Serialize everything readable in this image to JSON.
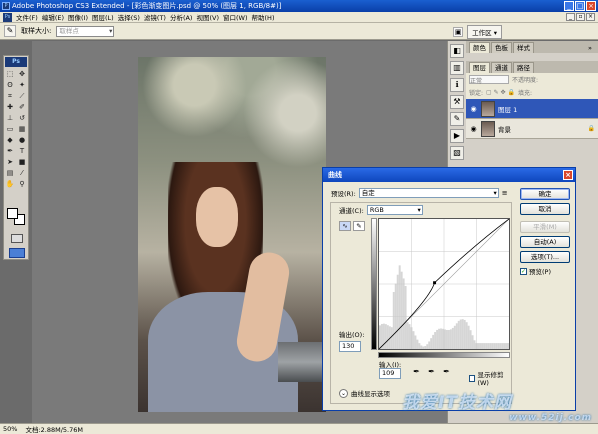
{
  "app": {
    "title": "Adobe Photoshop CS3 Extended - [彩色渐变图片.psd @ 50% (图层 1, RGB/8#)]",
    "ps_badge": "Ps"
  },
  "menubar": {
    "items": [
      "文件(F)",
      "编辑(E)",
      "图像(I)",
      "图层(L)",
      "选择(S)",
      "滤镜(T)",
      "分析(A)",
      "视图(V)",
      "窗口(W)",
      "帮助(H)"
    ]
  },
  "optionsbar": {
    "sample_size_label": "取样大小:",
    "sample_size_value": "取样点",
    "workspace_label": "工作区 ▾"
  },
  "panels": {
    "top_tabs": [
      "颜色",
      "色板",
      "样式"
    ],
    "layer_tabs": [
      "图层",
      "通道",
      "路径"
    ],
    "blend_mode": "正常",
    "opacity_label": "不透明度:",
    "lock_label": "锁定:",
    "fill_label": "填充:",
    "layers": [
      {
        "name": "图层 1",
        "selected": true
      },
      {
        "name": "背景",
        "selected": false
      }
    ]
  },
  "status": {
    "zoom": "50%",
    "doc_info": "文档:2.88M/5.76M"
  },
  "curves_dialog": {
    "title": "曲线",
    "preset_label": "预设(R):",
    "preset_value": "自定",
    "channel_label": "通道(C):",
    "channel_value": "RGB",
    "output_label": "输出(O):",
    "output_value": "130",
    "input_label": "输入(I):",
    "input_value": "109",
    "clipping_label": "显示修剪(W)",
    "display_options_label": "曲线显示选项",
    "buttons": {
      "ok": "确定",
      "cancel": "取消",
      "smooth": "平滑(M)",
      "auto": "自动(A)",
      "options": "选项(T)...",
      "preview": "预览(P)"
    },
    "preview_checked": true,
    "curve_point": {
      "input": 109,
      "output": 130
    }
  },
  "watermark": {
    "text": "我爱IT技术网",
    "sub": "www.52ij.com"
  }
}
